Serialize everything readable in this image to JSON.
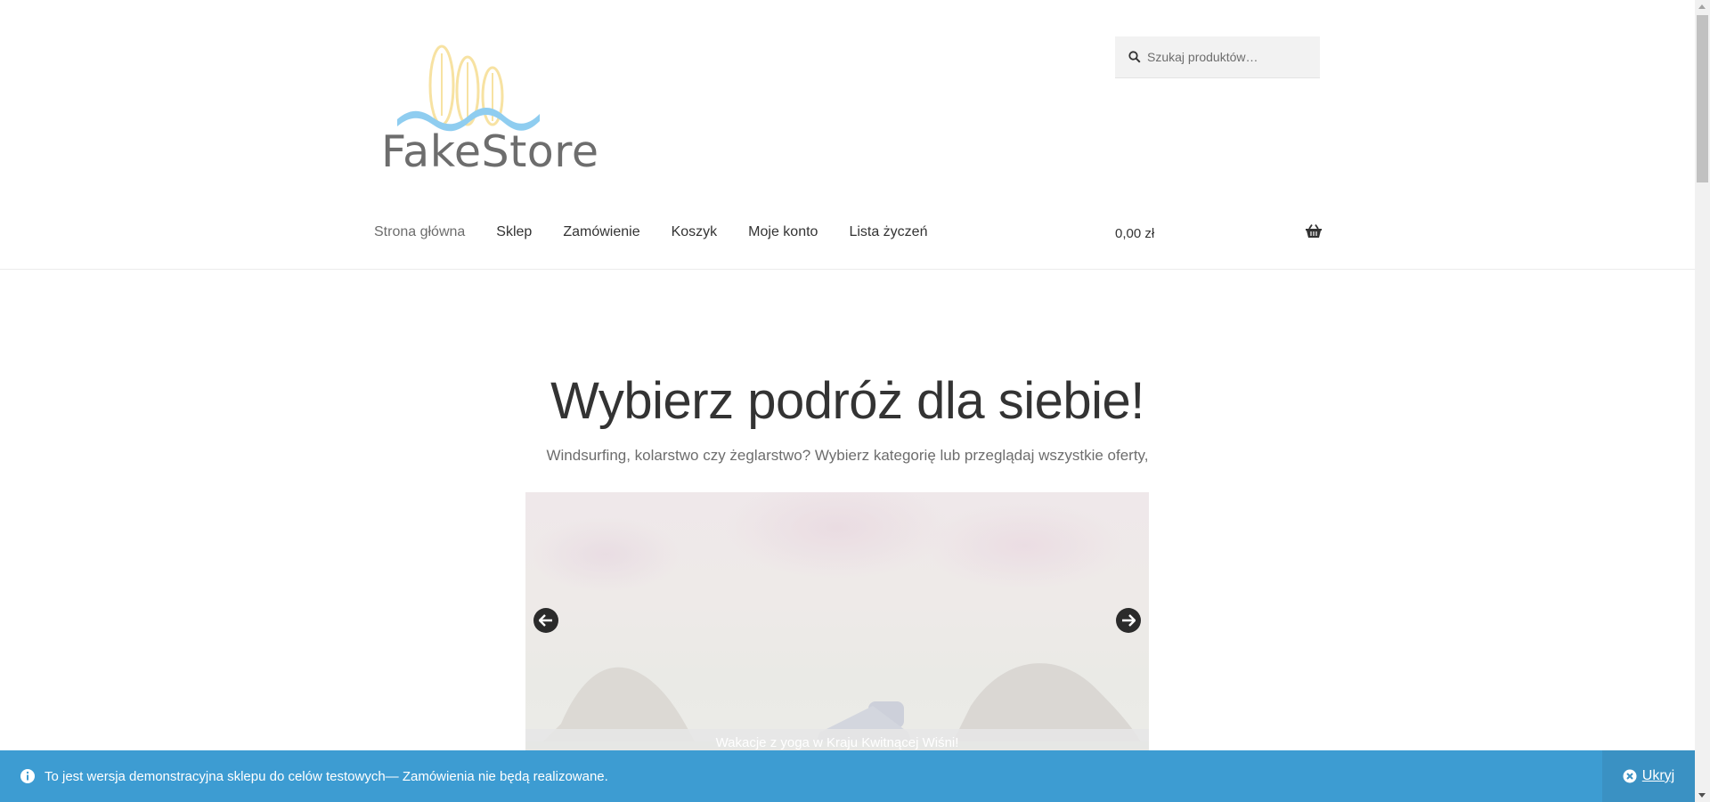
{
  "brand": {
    "name": "FakeStore"
  },
  "search": {
    "placeholder": "Szukaj produktów…"
  },
  "nav": {
    "items": [
      {
        "label": "Strona główna",
        "active": true
      },
      {
        "label": "Sklep"
      },
      {
        "label": "Zamówienie"
      },
      {
        "label": "Koszyk"
      },
      {
        "label": "Moje konto"
      },
      {
        "label": "Lista życzeń"
      }
    ]
  },
  "cart": {
    "total": "0,00 zł",
    "icon": "basket-icon"
  },
  "hero": {
    "title": "Wybierz podróż dla siebie!",
    "subtitle": "Windsurfing, kolarstwo czy żeglarstwo? Wybierz kategorię lub przeglądaj wszystkie oferty,"
  },
  "slider": {
    "caption": "Wakacje z yoga w Kraju Kwitnącej Wiśni!",
    "prev_icon": "arrow-left-icon",
    "next_icon": "arrow-right-icon"
  },
  "notice": {
    "text": "To jest wersja demonstracyjna sklepu do celów testowych— Zamówienia nie będą realizowane.",
    "dismiss_label": "Ukryj"
  },
  "colors": {
    "notice_bg": "#3d9cd2",
    "text_dark": "#333333",
    "text_muted": "#6d6d6d"
  }
}
